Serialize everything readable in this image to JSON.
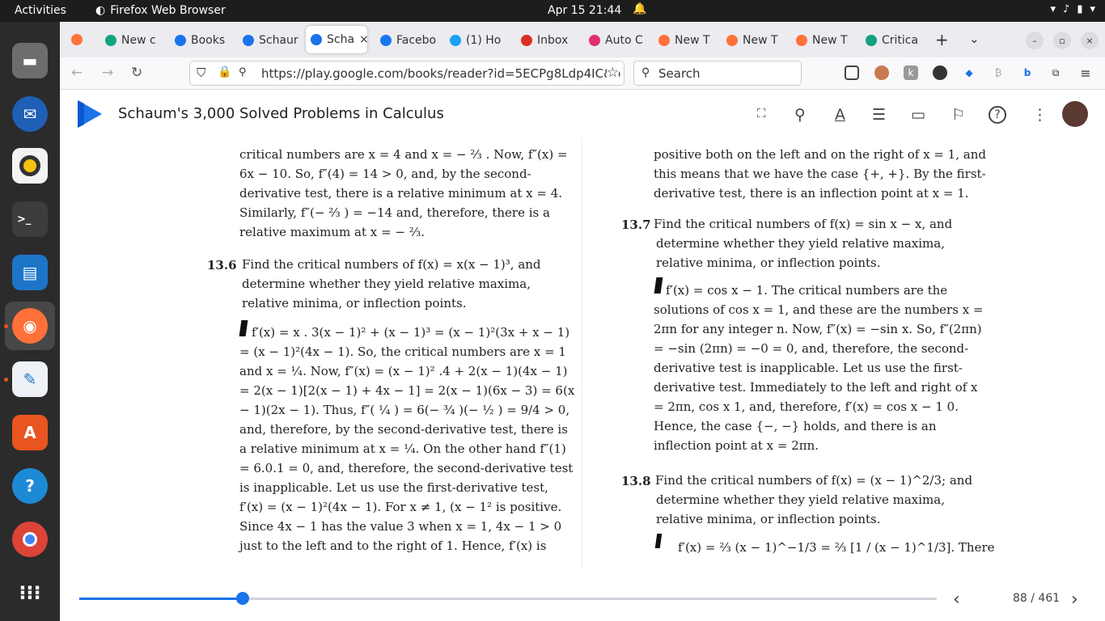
{
  "system_bar": {
    "activities": "Activities",
    "app_name": "Firefox Web Browser",
    "clock": "Apr 15  21:44"
  },
  "tabs": [
    {
      "label": "New c",
      "color": "#10a37f"
    },
    {
      "label": "Books",
      "color": "#1a73e8"
    },
    {
      "label": "Schaur",
      "color": "#1a73e8"
    },
    {
      "label": "Scha",
      "color": "#1a73e8"
    },
    {
      "label": "Facebo",
      "color": "#1877f2"
    },
    {
      "label": "(1) Ho",
      "color": "#1da1f2"
    },
    {
      "label": "Inbox",
      "color": "#d93025"
    },
    {
      "label": "Auto C",
      "color": "#e1306c"
    },
    {
      "label": "New T",
      "color": "#ff7139"
    },
    {
      "label": "New T",
      "color": "#ff7139"
    },
    {
      "label": "New T",
      "color": "#ff7139"
    },
    {
      "label": "Critica",
      "color": "#10a37f"
    }
  ],
  "nav": {
    "url": "https://play.google.com/books/reader?id=5ECPg8Ldp4IC&p",
    "search_placeholder": "Search"
  },
  "book": {
    "title": "Schaum's 3,000 Solved Problems in Calculus",
    "page_indicator": "88 / 461",
    "progress_fraction": 0.191
  },
  "content": {
    "left": [
      "critical numbers are x = 4 and x = − ⅔ . Now, f″(x) =",
      "6x − 10. So, f″(4) = 14 > 0, and, by the second-",
      "derivative test, there is a relative minimum at x = 4.",
      "Similarly, f″(− ⅔ ) = −14 and, therefore, there is a",
      "relative maximum at x = − ⅔."
    ],
    "p136_num": "13.6",
    "p136_q": [
      "Find the critical numbers of f(x) = x(x − 1)³, and",
      "determine whether they yield relative maxima,",
      "relative minima, or inflection points."
    ],
    "p136_a": [
      "f′(x) = x . 3(x − 1)² + (x − 1)³ = (x − 1)²(3x + x − 1)",
      "= (x − 1)²(4x − 1). So, the critical numbers are x = 1",
      "and x = ¼. Now, f″(x) = (x − 1)² .4 + 2(x − 1)(4x − 1)",
      "= 2(x − 1)[2(x − 1) + 4x − 1] = 2(x − 1)(6x − 3) = 6(x",
      "− 1)(2x − 1). Thus, f″( ¼ ) = 6(− ¾ )(− ½ ) = 9/4 > 0,",
      "and, therefore, by the second-derivative test, there is",
      "a relative minimum at x = ¼. On the other hand f″(1)",
      "= 6.0.1 = 0, and, therefore, the second-derivative test",
      "is inapplicable. Let us use the first-derivative test,",
      "f′(x) = (x − 1)²(4x − 1). For x ≠ 1, (x − 1² is positive.",
      "Since 4x − 1 has the value 3 when x = 1, 4x − 1 > 0",
      "just to the left and to the right of 1. Hence, f′(x) is"
    ],
    "right_top": [
      "positive both on the left and on the right of x = 1, and",
      "this means that we have the case {+, +}. By the first-",
      "derivative test, there is an inflection point at x = 1."
    ],
    "p137_num": "13.7",
    "p137_q": [
      "Find the critical numbers of f(x) = sin x − x, and",
      "determine whether they yield relative maxima,",
      "relative minima, or inflection points."
    ],
    "p137_a": [
      "f′(x) = cos x − 1. The critical numbers are the",
      "solutions of cos x = 1, and these are the numbers x =",
      "2πn for any integer n. Now, f″(x) = −sin x. So, f″(2πn)",
      "= −sin (2πn) = −0 = 0, and, therefore, the second-",
      "derivative test is inapplicable. Let us use the first-",
      "derivative test. Immediately to the left and right of x",
      "= 2πn, cos x 1, and, therefore, f′(x) = cos x − 1 0.",
      "Hence, the case {−, −} holds, and there is an",
      "inflection point at x = 2πn."
    ],
    "p138_num": "13.8",
    "p138_q": [
      "Find the critical numbers of f(x) = (x − 1)^2/3; and",
      "determine whether they yield relative maxima,",
      "relative minima, or inflection points."
    ],
    "p138_a": "f′(x) = ⅔ (x − 1)^−1/3 = ⅔ [1 / (x − 1)^1/3]. There"
  }
}
